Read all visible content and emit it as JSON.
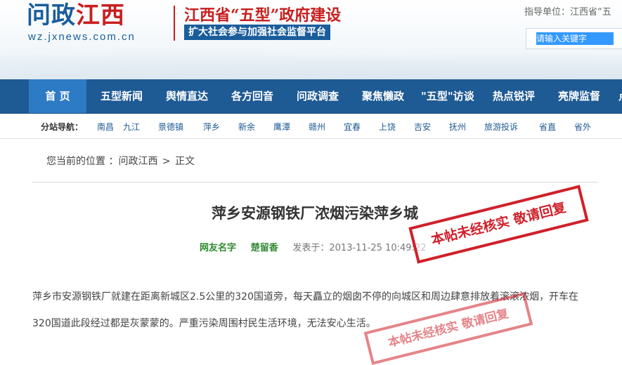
{
  "header": {
    "logo_part1": "问政",
    "logo_part2": "江西",
    "logo_url": "wz.jxnews.com.cn",
    "slogan1": "江西省“五型”政府建设",
    "slogan2": "扩大社会参与加强社会监督平台",
    "guide_text": "指导单位：江西省“五",
    "search_placeholder": "请输入关键字"
  },
  "nav": {
    "items": [
      "首 页",
      "五型新闻",
      "舆情直达",
      "各方回音",
      "问政调查",
      "聚焦懒政",
      "\"五型\"访谈",
      "热点锐评",
      "亮牌监督",
      "点"
    ]
  },
  "subnav": {
    "label": "分站导航：",
    "items": [
      "南昌",
      "九江",
      "景德镇",
      "萍乡",
      "新余",
      "鹰潭",
      "赣州",
      "宜春",
      "上饶",
      "吉安",
      "抚州",
      "旅游投诉",
      "省直",
      "省外"
    ]
  },
  "breadcrumb": {
    "prefix": "您当前的位置 ：",
    "site": "问政江西",
    "sep": ">",
    "current": "正文"
  },
  "article": {
    "title": "萍乡安源钢铁厂浓烟污染萍乡城",
    "author_label": "网友名字",
    "author": "楚留香",
    "posted_label": "发表于：",
    "posted_time": "2013-11-25 10:49:22",
    "body": "萍乡市安源钢铁厂就建在距离新城区2.5公里的320国道旁，每天矗立的烟囱不停的向城区和周边肆意排放着滚滚浓烟，开车在320国道此段经过都是灰蒙蒙的。严重污染周围村民生活环境，无法安心生活。"
  },
  "stamp": {
    "text": "本帖未经核实 敬请回复",
    "color": "#d0202a"
  },
  "colors": {
    "nav_bg": "#1e5a94",
    "nav_active": "#2d7bc4",
    "brand_red": "#c81e1e"
  }
}
